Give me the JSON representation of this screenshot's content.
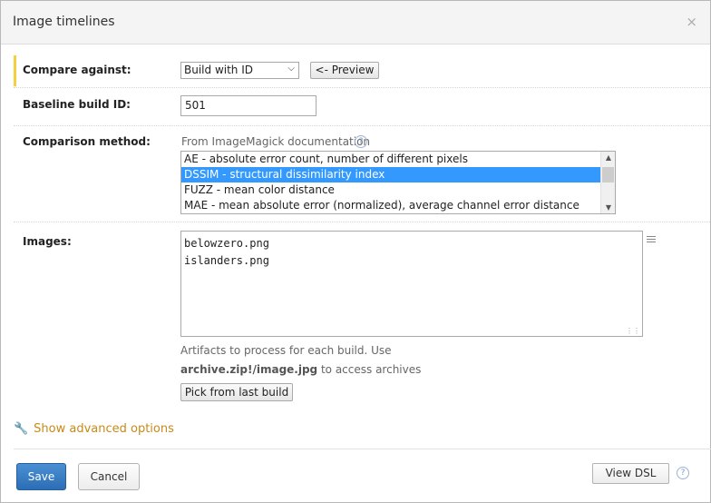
{
  "dialog": {
    "title": "Image timelines",
    "close_glyph": "×"
  },
  "compare": {
    "label": "Compare against:",
    "selected": "Build with ID",
    "preview_button": "<- Preview"
  },
  "baseline": {
    "label": "Baseline build ID:",
    "value": "501"
  },
  "method": {
    "label": "Comparison method:",
    "hint": "From ImageMagick documentation",
    "options": [
      "AE - absolute error count, number of different pixels",
      "DSSIM - structural dissimilarity index",
      "FUZZ - mean color distance",
      "MAE - mean absolute error (normalized), average channel error distance"
    ],
    "selected_index": 1
  },
  "images": {
    "label": "Images:",
    "lines": [
      "belowzero.png",
      "islanders.png"
    ],
    "help_line1": "Artifacts to process for each build. Use",
    "help_code": "archive.zip!/image.jpg",
    "help_line2_rest": " to access archives",
    "pick_button": "Pick from last build"
  },
  "advanced": {
    "label": "Show advanced options"
  },
  "footer": {
    "save": "Save",
    "cancel": "Cancel",
    "view_dsl": "View DSL"
  },
  "colors": {
    "accent_bar": "#f4d03f",
    "selection": "#3399ff",
    "primary_button": "#2c6eb5",
    "link": "#c88a18"
  }
}
